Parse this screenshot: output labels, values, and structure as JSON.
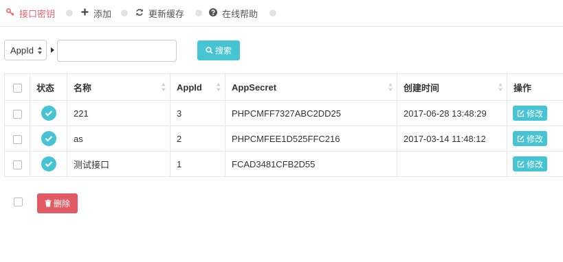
{
  "nav": {
    "tabs": [
      {
        "label": "接口密钥",
        "icon": "key-icon",
        "active": true
      },
      {
        "label": "添加",
        "icon": "plus-icon",
        "active": false
      },
      {
        "label": "更新缓存",
        "icon": "refresh-icon",
        "active": false
      },
      {
        "label": "在线帮助",
        "icon": "question-circle-icon",
        "active": false
      }
    ]
  },
  "search": {
    "field_select_value": "AppId",
    "input_value": "",
    "button_label": "搜索",
    "button_icon": "search-icon"
  },
  "table": {
    "columns": [
      "",
      "状态",
      "名称",
      "AppId",
      "AppSecret",
      "创建时间",
      "操作"
    ],
    "sortable_columns": [
      "名称",
      "AppId",
      "AppSecret",
      "创建时间"
    ],
    "rows": [
      {
        "status": "enabled",
        "name": "221",
        "appid": "3",
        "secret": "PHPCMFF7327ABC2DD25",
        "created": "2017-06-28 13:48:29",
        "action": "修改"
      },
      {
        "status": "enabled",
        "name": "as",
        "appid": "2",
        "secret": "PHPCMFEE1D525FFC216",
        "created": "2017-03-14 11:48:12",
        "action": "修改"
      },
      {
        "status": "enabled",
        "name": "测试接口",
        "appid": "1",
        "secret": "FCAD3481CFB2D55",
        "created": "",
        "action": "修改"
      }
    ]
  },
  "footer": {
    "delete_label": "删除",
    "delete_icon": "trash-icon"
  },
  "colors": {
    "accent": "#46c4d3",
    "active_tab": "#e8646d",
    "danger": "#e25a63",
    "border": "#e6e6e6"
  }
}
